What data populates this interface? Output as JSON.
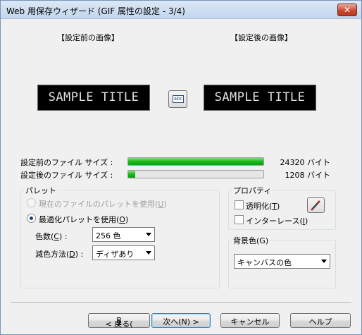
{
  "window": {
    "title": "Web 用保存ウィザード (GIF 属性の設定 - 3/4)",
    "close_glyph": "✕"
  },
  "preview": {
    "before_label": "【設定前の画像】",
    "after_label": "【設定後の画像】",
    "before_sample_text": "SAMPLE TITLE",
    "after_sample_text": "SAMPLE TITLE",
    "preview_button_icon": "abc-preview-icon",
    "preview_button_icon_text": "abc"
  },
  "file_size": {
    "before_label": "設定前のファイル サイズ :",
    "after_label": "設定後のファイル サイズ :",
    "before_value": "24320 バイト",
    "after_value": "1208 バイト",
    "before_fraction": 1.0,
    "after_fraction": 0.05,
    "bar_color": "#19b919"
  },
  "palette": {
    "group_title": "パレット",
    "current_file_palette": {
      "text": "現在のファイルのパレットを使用(",
      "key": "U",
      "end": ")",
      "checked": false,
      "disabled": true
    },
    "optimized_palette": {
      "text": "最適化パレットを使用(",
      "key": "O",
      "end": ")",
      "checked": true,
      "disabled": false
    },
    "colors_label": {
      "text": "色数(",
      "key": "C",
      "end": ") :"
    },
    "colors_value": "256 色",
    "reduction_label": {
      "text": "減色方法(",
      "key": "D",
      "end": ") :"
    },
    "reduction_value": "ディザあり"
  },
  "properties": {
    "group_title": "プロパティ",
    "transparency": {
      "text": "透明化(",
      "key": "T",
      "end": ")",
      "checked": false
    },
    "interlace": {
      "text": "インターレース(",
      "key": "I",
      "end": ")",
      "checked": false
    },
    "pencil_icon": "pencil-icon"
  },
  "background": {
    "group_title": "背景色(G)",
    "value": "キャンバスの色"
  },
  "buttons": {
    "back": {
      "text": "< 戻る(",
      "key": "B",
      "end": ")"
    },
    "next": {
      "text": "次へ(N) >"
    },
    "cancel": "キャンセル",
    "help": "ヘルプ"
  },
  "colors": {
    "titlebar": "#c3d6ed",
    "close_button": "#c8442c",
    "sample_bg": "#000000",
    "progress_fill": "#19b919"
  }
}
